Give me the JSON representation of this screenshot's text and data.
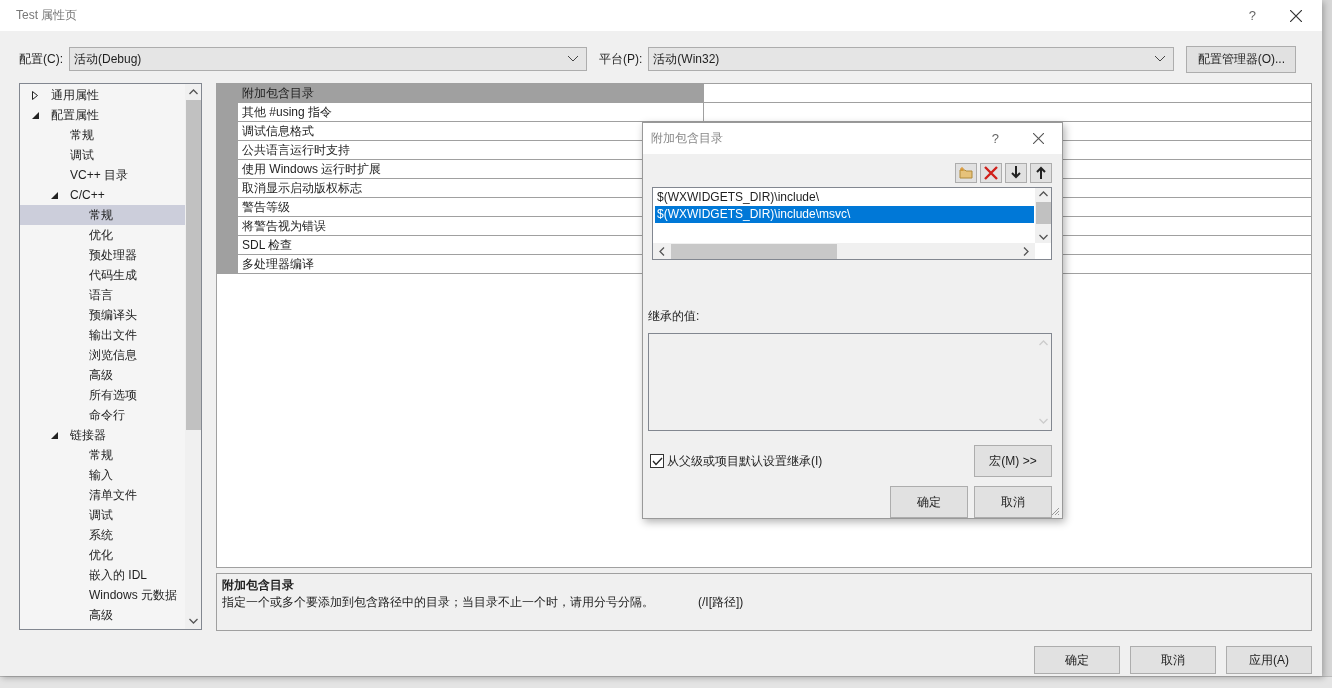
{
  "window": {
    "title": "Test 属性页",
    "help": "?"
  },
  "config_bar": {
    "config_label": "配置(C):",
    "config_value": "活动(Debug)",
    "platform_label": "平台(P):",
    "platform_value": "活动(Win32)",
    "manager_button": "配置管理器(O)..."
  },
  "tree": [
    {
      "label": "通用属性",
      "expanded": false,
      "selected": false
    },
    {
      "label": "配置属性",
      "expanded": true,
      "selected": false,
      "children": [
        {
          "label": "常规",
          "selected": false
        },
        {
          "label": "调试",
          "selected": false
        },
        {
          "label": "VC++ 目录",
          "selected": false
        },
        {
          "label": "C/C++",
          "expanded": true,
          "selected": false,
          "children": [
            {
              "label": "常规",
              "selected": true
            },
            {
              "label": "优化",
              "selected": false
            },
            {
              "label": "预处理器",
              "selected": false
            },
            {
              "label": "代码生成",
              "selected": false
            },
            {
              "label": "语言",
              "selected": false
            },
            {
              "label": "预编译头",
              "selected": false
            },
            {
              "label": "输出文件",
              "selected": false
            },
            {
              "label": "浏览信息",
              "selected": false
            },
            {
              "label": "高级",
              "selected": false
            },
            {
              "label": "所有选项",
              "selected": false
            },
            {
              "label": "命令行",
              "selected": false
            }
          ]
        },
        {
          "label": "链接器",
          "expanded": true,
          "selected": false,
          "children": [
            {
              "label": "常规",
              "selected": false
            },
            {
              "label": "输入",
              "selected": false
            },
            {
              "label": "清单文件",
              "selected": false
            },
            {
              "label": "调试",
              "selected": false
            },
            {
              "label": "系统",
              "selected": false
            },
            {
              "label": "优化",
              "selected": false
            },
            {
              "label": "嵌入的 IDL",
              "selected": false
            },
            {
              "label": "Windows 元数据",
              "selected": false
            },
            {
              "label": "高级",
              "selected": false
            }
          ]
        }
      ]
    }
  ],
  "properties": [
    {
      "name": "附加包含目录",
      "selected": true
    },
    {
      "name": "其他 #using 指令",
      "selected": false
    },
    {
      "name": "调试信息格式",
      "selected": false
    },
    {
      "name": "公共语言运行时支持",
      "selected": false
    },
    {
      "name": "使用 Windows 运行时扩展",
      "selected": false
    },
    {
      "name": "取消显示启动版权标志",
      "selected": false
    },
    {
      "name": "警告等级",
      "selected": false
    },
    {
      "name": "将警告视为错误",
      "selected": false
    },
    {
      "name": "SDL 检查",
      "selected": false
    },
    {
      "name": "多处理器编译",
      "selected": false
    }
  ],
  "description": {
    "title": "附加包含目录",
    "text": "指定一个或多个要添加到包含路径中的目录；当目录不止一个时，请用分号分隔。",
    "command_line_flag": "(/I[路径])"
  },
  "buttons": [
    "确定",
    "取消",
    "应用(A)"
  ],
  "dialog": {
    "title": "附加包含目录",
    "help": "?",
    "entries": [
      {
        "text": "$(WXWIDGETS_DIR)\\include\\",
        "selected": false
      },
      {
        "text": "$(WXWIDGETS_DIR)\\include\\msvc\\",
        "selected": true
      }
    ],
    "inherited_label": "继承的值:",
    "inherit_checkbox": {
      "label": "从父级或项目默认设置继承(I)",
      "checked": true
    },
    "macro_button": "宏(M) >>",
    "buttons": [
      "确定",
      "取消"
    ]
  }
}
